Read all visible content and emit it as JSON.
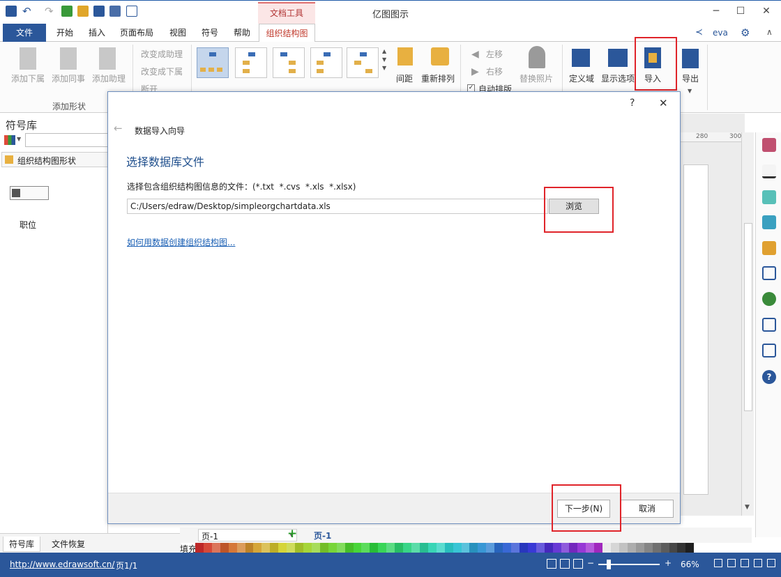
{
  "app": {
    "title": "亿图图示"
  },
  "tabs": {
    "context_header": "文档工具",
    "items": [
      "文件",
      "开始",
      "插入",
      "页面布局",
      "视图",
      "符号",
      "帮助",
      "组织结构图"
    ]
  },
  "user": {
    "name": "eva"
  },
  "ribbon": {
    "add_sub": "添加下属",
    "add_peer": "添加同事",
    "add_assistant": "添加助理",
    "group_add_shape": "添加形状",
    "to_assistant": "改变成助理",
    "to_sub": "改变成下属",
    "disconnect": "断开",
    "spacing": "间距",
    "rearrange": "重新排列",
    "move_left": "左移",
    "move_right": "右移",
    "auto_layout": "自动排版",
    "replace_photo": "替换照片",
    "define_field": "定义域",
    "display_options": "显示选项",
    "import": "导入",
    "export": "导出"
  },
  "left_panel": {
    "title": "符号库",
    "category": "组织结构图形状",
    "item_label": "职位"
  },
  "ruler": {
    "t1": "280",
    "t2": "300"
  },
  "dialog": {
    "help": "?",
    "close": "✕",
    "back": "←",
    "wizard_title": "数据导入向导",
    "heading": "选择数据库文件",
    "instruction": "选择包含组织结构图信息的文件：(*.txt  *.cvs  *.xls  *.xlsx)",
    "file_path": "C:/Users/edraw/Desktop/simpleorgchartdata.xls",
    "browse": "浏览",
    "help_link": "如何用数据创建组织结构图...",
    "next": "下一步(N)",
    "cancel": "取消"
  },
  "bottom": {
    "tab_symbols": "符号库",
    "tab_recovery": "文件恢复",
    "page_dropdown": "页-1",
    "page_add": "+",
    "page_tab": "页-1",
    "fill_label": "填充"
  },
  "status": {
    "url": "http://www.edrawsoft.cn/",
    "page": "页1/1",
    "zoom_minus": "−",
    "zoom_plus": "+",
    "zoom": "66%"
  },
  "colors": {
    "accent": "#2b579a",
    "highlight": "#e0242a",
    "context_tab": "#c0392b"
  }
}
